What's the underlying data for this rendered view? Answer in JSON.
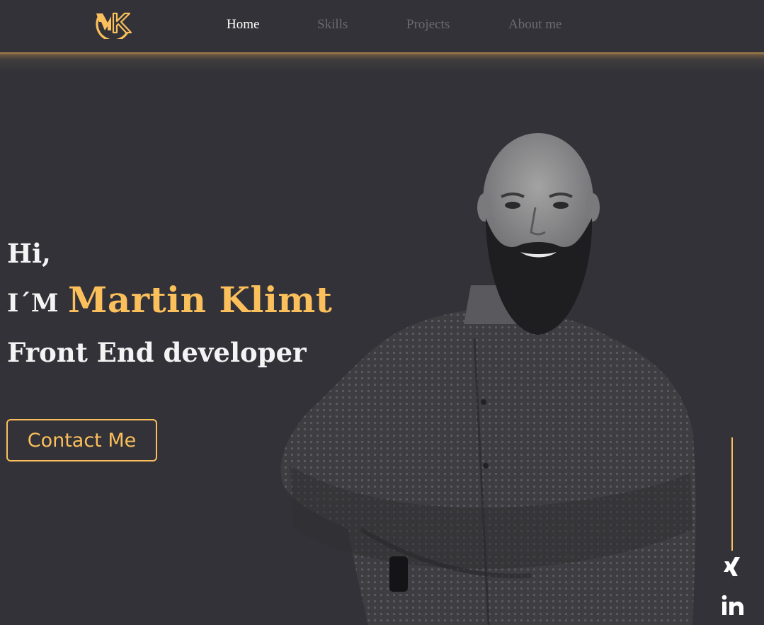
{
  "header": {
    "logo_text": "MK",
    "nav": [
      {
        "label": "Home",
        "active": true
      },
      {
        "label": "Skills",
        "active": false
      },
      {
        "label": "Projects",
        "active": false
      },
      {
        "label": "About me",
        "active": false
      }
    ]
  },
  "hero": {
    "greeting": "Hi,",
    "intro": "I´M",
    "name": "Martin Klimt",
    "role": "Front End developer",
    "cta_label": "Contact Me"
  },
  "social": {
    "icons": [
      "xing-icon",
      "linkedin-icon"
    ]
  },
  "colors": {
    "background": "#323238",
    "accent": "#fbbf5b",
    "text": "#f4f4f4",
    "nav_inactive": "#6a6a6f"
  }
}
